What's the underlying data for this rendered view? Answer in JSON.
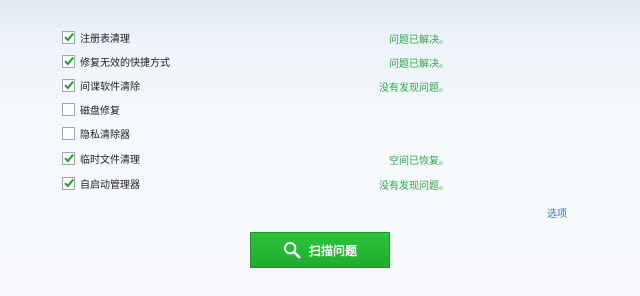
{
  "items": [
    {
      "label": "注册表清理",
      "checked": true,
      "status": "问题已解决。"
    },
    {
      "label": "修复无效的快捷方式",
      "checked": true,
      "status": "问题已解决。"
    },
    {
      "label": "间谍软件清除",
      "checked": true,
      "status": "没有发现问题。"
    },
    {
      "label": "磁盘修复",
      "checked": false,
      "status": ""
    },
    {
      "label": "隐私清除器",
      "checked": false,
      "status": ""
    },
    {
      "label": "临时文件清理",
      "checked": true,
      "status": "空间已恢复。"
    },
    {
      "label": "自启动管理器",
      "checked": true,
      "status": "没有发现问题。"
    }
  ],
  "options_label": "选项",
  "scan_button": {
    "label": "扫描问题",
    "icon": "search-icon"
  },
  "colors": {
    "accent_green": "#22b231",
    "status_green": "#2fa84f",
    "check_green": "#1e9e2a",
    "link_blue": "#3a77c6"
  }
}
